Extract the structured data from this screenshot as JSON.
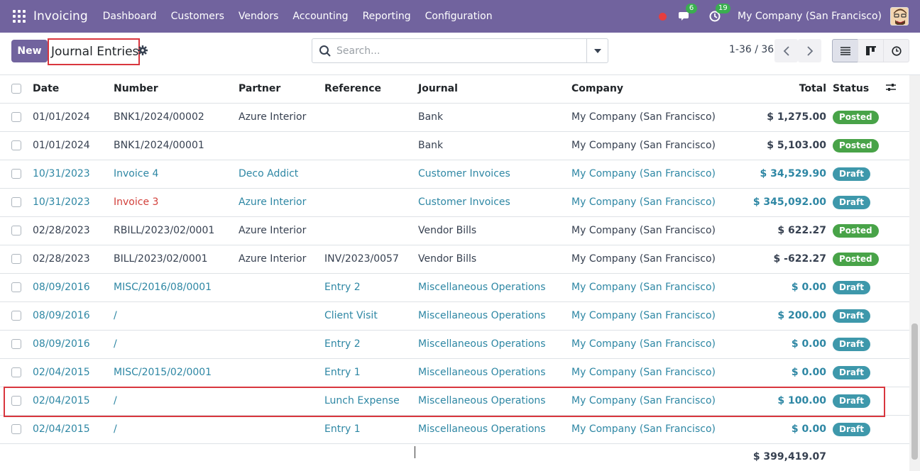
{
  "navbar": {
    "app_name": "Invoicing",
    "menu": [
      "Dashboard",
      "Customers",
      "Vendors",
      "Accounting",
      "Reporting",
      "Configuration"
    ],
    "messages_count": "6",
    "activities_count": "19",
    "company": "My Company (San Francisco)",
    "accent_color": "#71639e"
  },
  "control": {
    "new_label": "New",
    "title": "Journal Entries",
    "search_placeholder": "Search...",
    "pager": "1-36 / 36"
  },
  "table": {
    "headers": {
      "date": "Date",
      "number": "Number",
      "partner": "Partner",
      "reference": "Reference",
      "journal": "Journal",
      "company": "Company",
      "total": "Total",
      "status": "Status"
    },
    "rows": [
      {
        "date": "01/01/2024",
        "number": "BNK1/2024/00002",
        "partner": "Azure Interior",
        "reference": "",
        "journal": "Bank",
        "company": "My Company (San Francisco)",
        "total": "$ 1,275.00",
        "status": "Posted"
      },
      {
        "date": "01/01/2024",
        "number": "BNK1/2024/00001",
        "partner": "",
        "reference": "",
        "journal": "Bank",
        "company": "My Company (San Francisco)",
        "total": "$ 5,103.00",
        "status": "Posted"
      },
      {
        "date": "10/31/2023",
        "number": "Invoice 4",
        "partner": "Deco Addict",
        "reference": "",
        "journal": "Customer Invoices",
        "company": "My Company (San Francisco)",
        "total": "$ 34,529.90",
        "status": "Draft"
      },
      {
        "date": "10/31/2023",
        "number": "Invoice 3",
        "partner": "Azure Interior",
        "reference": "",
        "journal": "Customer Invoices",
        "company": "My Company (San Francisco)",
        "total": "$ 345,092.00",
        "status": "Draft"
      },
      {
        "date": "02/28/2023",
        "number": "RBILL/2023/02/0001",
        "partner": "Azure Interior",
        "reference": "",
        "journal": "Vendor Bills",
        "company": "My Company (San Francisco)",
        "total": "$ 622.27",
        "status": "Posted"
      },
      {
        "date": "02/28/2023",
        "number": "BILL/2023/02/0001",
        "partner": "Azure Interior",
        "reference": "INV/2023/0057",
        "journal": "Vendor Bills",
        "company": "My Company (San Francisco)",
        "total": "$ -622.27",
        "status": "Posted"
      },
      {
        "date": "08/09/2016",
        "number": "MISC/2016/08/0001",
        "partner": "",
        "reference": "Entry 2",
        "journal": "Miscellaneous Operations",
        "company": "My Company (San Francisco)",
        "total": "$ 0.00",
        "status": "Draft"
      },
      {
        "date": "08/09/2016",
        "number": "/",
        "partner": "",
        "reference": "Client Visit",
        "journal": "Miscellaneous Operations",
        "company": "My Company (San Francisco)",
        "total": "$ 200.00",
        "status": "Draft"
      },
      {
        "date": "08/09/2016",
        "number": "/",
        "partner": "",
        "reference": "Entry 2",
        "journal": "Miscellaneous Operations",
        "company": "My Company (San Francisco)",
        "total": "$ 0.00",
        "status": "Draft"
      },
      {
        "date": "02/04/2015",
        "number": "MISC/2015/02/0001",
        "partner": "",
        "reference": "Entry 1",
        "journal": "Miscellaneous Operations",
        "company": "My Company (San Francisco)",
        "total": "$ 0.00",
        "status": "Draft"
      },
      {
        "date": "02/04/2015",
        "number": "/",
        "partner": "",
        "reference": "Lunch Expense",
        "journal": "Miscellaneous Operations",
        "company": "My Company (San Francisco)",
        "total": "$ 100.00",
        "status": "Draft"
      },
      {
        "date": "02/04/2015",
        "number": "/",
        "partner": "",
        "reference": "Entry 1",
        "journal": "Miscellaneous Operations",
        "company": "My Company (San Francisco)",
        "total": "$ 0.00",
        "status": "Draft"
      }
    ],
    "grand_total": "$ 399,419.07",
    "status_colors": {
      "Posted": "#48a348",
      "Draft": "#3e98ab"
    }
  }
}
